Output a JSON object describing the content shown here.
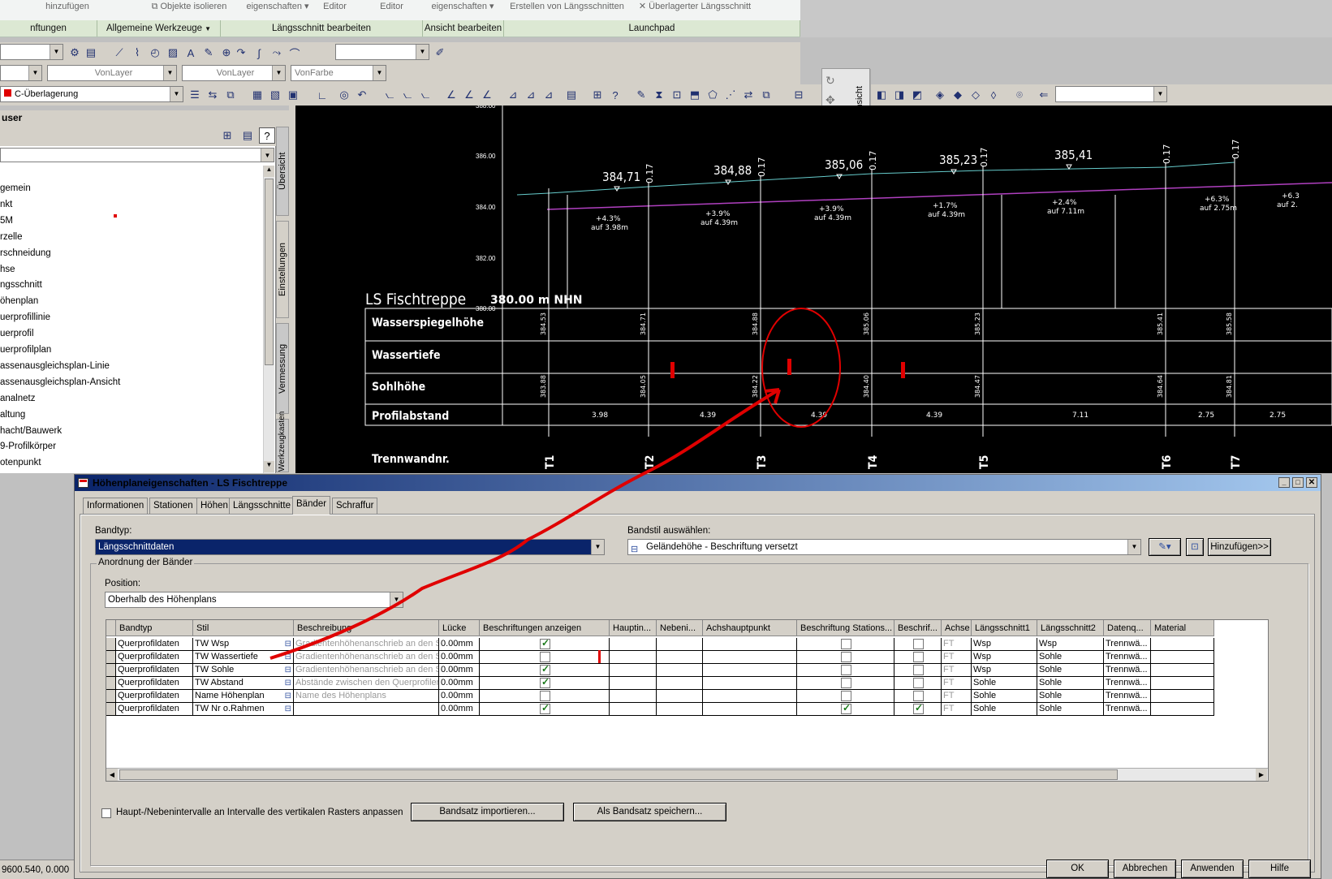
{
  "ribbon": {
    "tails": [
      "hinzufügen",
      "Objekte isolieren",
      "eigenschaften",
      "Editor",
      "Editor",
      "eigenschaften",
      "Erstellen von Längsschnitten",
      "Überlagerter Längsschnitt"
    ],
    "panels": [
      "nftungen",
      "Allgemeine Werkzeuge",
      "Längsschnitt bearbeiten",
      "Ansicht bearbeiten",
      "Launchpad"
    ]
  },
  "toolbar": {
    "layer_combo_1": "VonLayer",
    "layer_combo_2": "VonLayer",
    "color_combo": "VonFarbe",
    "overlay_combo": "C-Überlagerung"
  },
  "ansicht_tab": "Ansicht",
  "palette": {
    "title": "user",
    "items": [
      "gemein",
      "nkt",
      "5M",
      "rzelle",
      "rschneidung",
      "hse",
      "ngsschnitt",
      "öhenplan",
      "uerprofillinie",
      "uerprofil",
      "uerprofilplan",
      "assenausgleichsplan-Linie",
      "assenausgleichsplan-Ansicht",
      "analnetz",
      "altung",
      "hacht/Bauwerk",
      "9-Profilkörper",
      "otenpunkt"
    ],
    "side_tabs": [
      "Übersicht",
      "Einstellungen",
      "Vermessung",
      "Werkzeugkasten"
    ]
  },
  "drawing": {
    "title": "LS Fischtreppe",
    "datum": "380.00 m NHN",
    "top_datum": "388.00",
    "axis_ticks": [
      "386.00",
      "384.00",
      "382.00",
      "380.00"
    ],
    "band_labels": [
      "Wasserspiegelhöhe",
      "Wassertiefe",
      "Sohlhöhe",
      "Profilabstand",
      "Trennwandnr."
    ],
    "elev_labels": [
      "384,71",
      "384,88",
      "385,06",
      "385,23",
      "385,41"
    ],
    "height_marks": [
      "0.17",
      "0.17",
      "0.17",
      "0.17",
      "0.17",
      "0.17"
    ],
    "grades": [
      {
        "pct": "+4.3%",
        "len": "auf 3.98m"
      },
      {
        "pct": "+3.9%",
        "len": "auf 4.39m"
      },
      {
        "pct": "+3.9%",
        "len": "auf 4.39m"
      },
      {
        "pct": "+1.7%",
        "len": "auf 4.39m"
      },
      {
        "pct": "+2.4%",
        "len": "auf 7.11m"
      },
      {
        "pct": "+6.3%",
        "len": "auf 2.75m"
      },
      {
        "pct": "+6.3",
        "len": "auf 2."
      }
    ],
    "wsp_values": [
      "384.53",
      "384.71",
      "384.88",
      "385.06",
      "385.23",
      "385.41",
      "385.58"
    ],
    "sohl_values": [
      "383.88",
      "384.05",
      "384.22",
      "384.40",
      "384.47",
      "384.64",
      "384.81"
    ],
    "profil_values": [
      "3.98",
      "4.39",
      "4.39",
      "4.39",
      "7.11",
      "2.75",
      "2.75"
    ],
    "trennwand": [
      "T1",
      "T2",
      "T3",
      "T4",
      "T5",
      "T6",
      "T7"
    ]
  },
  "dialog": {
    "title": "Höhenplaneigenschaften - LS Fischtreppe",
    "tabs": [
      "Informationen",
      "Stationen",
      "Höhen",
      "Längsschnitte",
      "Bänder",
      "Schraffur"
    ],
    "bandtyp_label": "Bandtyp:",
    "bandtyp_value": "Längsschnittdaten",
    "bandstil_label": "Bandstil auswählen:",
    "bandstil_value": "Geländehöhe - Beschriftung versetzt",
    "add_button": "Hinzufügen>>",
    "group_label": "Anordnung der Bänder",
    "position_label": "Position:",
    "position_value": "Oberhalb des Höhenplans",
    "columns": [
      "Bandtyp",
      "Stil",
      "Beschreibung",
      "Lücke",
      "Beschriftungen anzeigen",
      "Hauptin...",
      "Nebeni...",
      "Achshauptpunkt",
      "Beschriftung Stations...",
      "Beschrif...",
      "Achse",
      "Längsschnitt1",
      "Längsschnitt2",
      "Datenq...",
      "Material"
    ],
    "rows": [
      {
        "bandtyp": "Querprofildaten",
        "stil": "TW Wsp",
        "beschreibung": "Gradientenhöhenanschrieb an den S...",
        "luecke": "0.00mm",
        "show": true,
        "stat": false,
        "beschr": false,
        "achse": "FT",
        "ls1": "Wsp",
        "ls2": "Wsp",
        "datenq": "Trennwä..."
      },
      {
        "bandtyp": "Querprofildaten",
        "stil": "TW Wassertiefe",
        "beschreibung": "Gradientenhöhenanschrieb an den S...",
        "luecke": "0.00mm",
        "show": false,
        "stat": false,
        "beschr": false,
        "achse": "FT",
        "ls1": "Wsp",
        "ls2": "Sohle",
        "datenq": "Trennwä..."
      },
      {
        "bandtyp": "Querprofildaten",
        "stil": "TW Sohle",
        "beschreibung": "Gradientenhöhenanschrieb an den S...",
        "luecke": "0.00mm",
        "show": true,
        "stat": false,
        "beschr": false,
        "achse": "FT",
        "ls1": "Wsp",
        "ls2": "Sohle",
        "datenq": "Trennwä..."
      },
      {
        "bandtyp": "Querprofildaten",
        "stil": "TW Abstand",
        "beschreibung": "Abstände zwischen den Querprofilen.",
        "luecke": "0.00mm",
        "show": true,
        "stat": false,
        "beschr": false,
        "achse": "FT",
        "ls1": "Sohle",
        "ls2": "Sohle",
        "datenq": "Trennwä..."
      },
      {
        "bandtyp": "Querprofildaten",
        "stil": "Name Höhenplan",
        "beschreibung": "Name des  Höhenplans",
        "luecke": "0.00mm",
        "show": false,
        "stat": false,
        "beschr": false,
        "achse": "FT",
        "ls1": "Sohle",
        "ls2": "Sohle",
        "datenq": "Trennwä..."
      },
      {
        "bandtyp": "Querprofildaten",
        "stil": "TW Nr o.Rahmen",
        "beschreibung": "",
        "luecke": "0.00mm",
        "show": true,
        "stat": true,
        "beschr": true,
        "achse": "FT",
        "ls1": "Sohle",
        "ls2": "Sohle",
        "datenq": "Trennwä..."
      }
    ],
    "checkbox_label": "Haupt-/Nebenintervalle an Intervalle des vertikalen Rasters anpassen",
    "import_button": "Bandsatz importieren...",
    "save_button": "Als Bandsatz speichern...",
    "ok": "OK",
    "cancel": "Abbrechen",
    "apply": "Anwenden",
    "help": "Hilfe"
  },
  "status": {
    "coords": "9600.540, 0.000"
  },
  "colors": {
    "annotation": "#e00000",
    "profile_line": "#b040c0",
    "terrain": "#66cccc",
    "title_bar": "#0a246a",
    "ribbon_panel": "#dce8d3"
  }
}
